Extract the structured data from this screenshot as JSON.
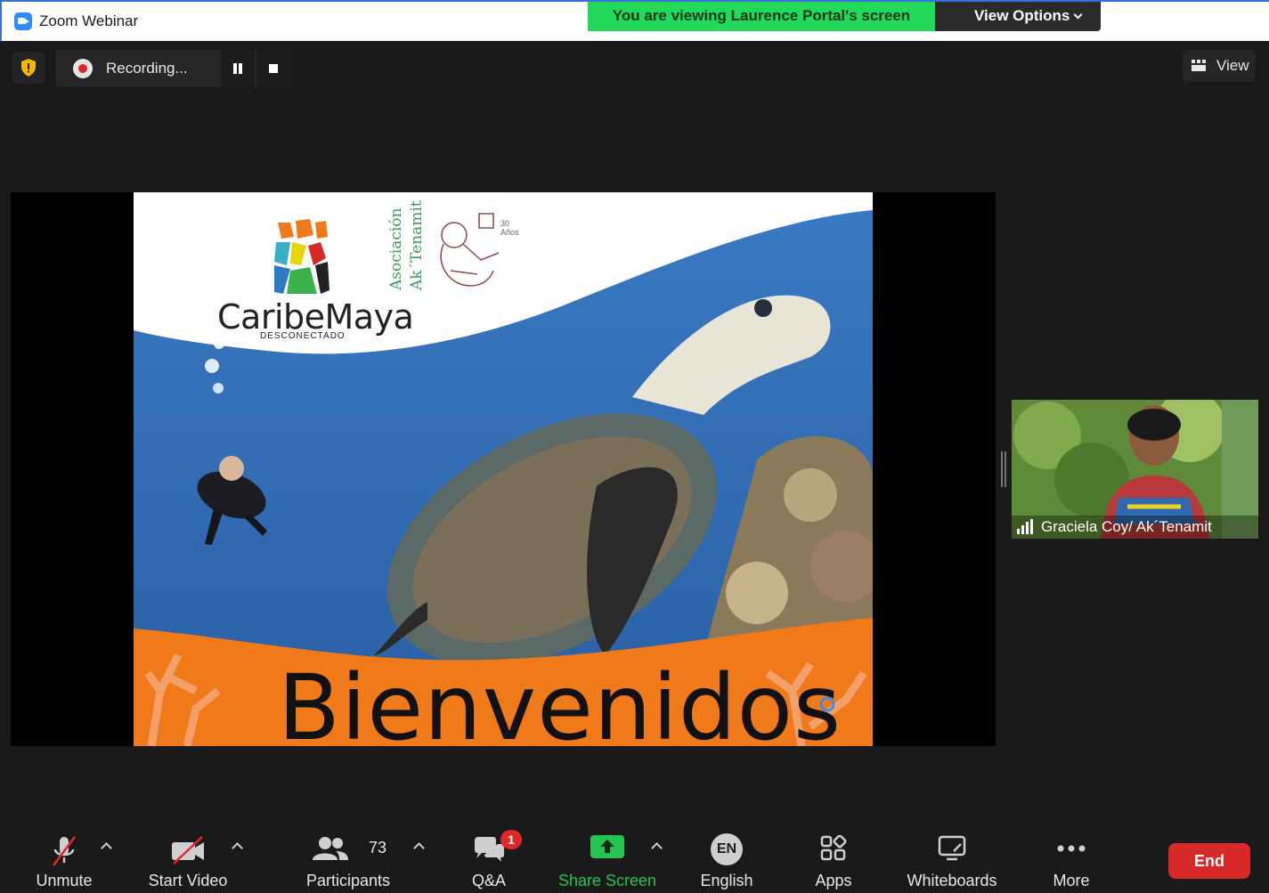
{
  "window": {
    "title": "Zoom Webinar"
  },
  "banner": {
    "viewing_text": "You are viewing Laurence Portal's screen",
    "view_options_label": "View Options"
  },
  "recording": {
    "status_text": "Recording..."
  },
  "view": {
    "label": "View"
  },
  "slide": {
    "brand_name": "CaribeMaya",
    "brand_tagline": "DESCONECTADO",
    "org_line1": "Asociación",
    "org_line2": "Ak´Tenamit",
    "anniversary_number": "30",
    "anniversary_unit": "Años",
    "welcome_text": "Bienvenidos"
  },
  "participant_tile": {
    "name": "Graciela Coy/  Ak´Tenamit"
  },
  "toolbar": {
    "unmute": "Unmute",
    "start_video": "Start Video",
    "participants": "Participants",
    "participant_count": "73",
    "qa": "Q&A",
    "qa_badge": "1",
    "share_screen": "Share Screen",
    "language_code": "EN",
    "language": "English",
    "apps": "Apps",
    "whiteboards": "Whiteboards",
    "more": "More",
    "end": "End"
  },
  "colors": {
    "banner_green": "#23d959",
    "end_red": "#d82828",
    "share_green": "#23c552",
    "slide_orange": "#f07a1a"
  }
}
